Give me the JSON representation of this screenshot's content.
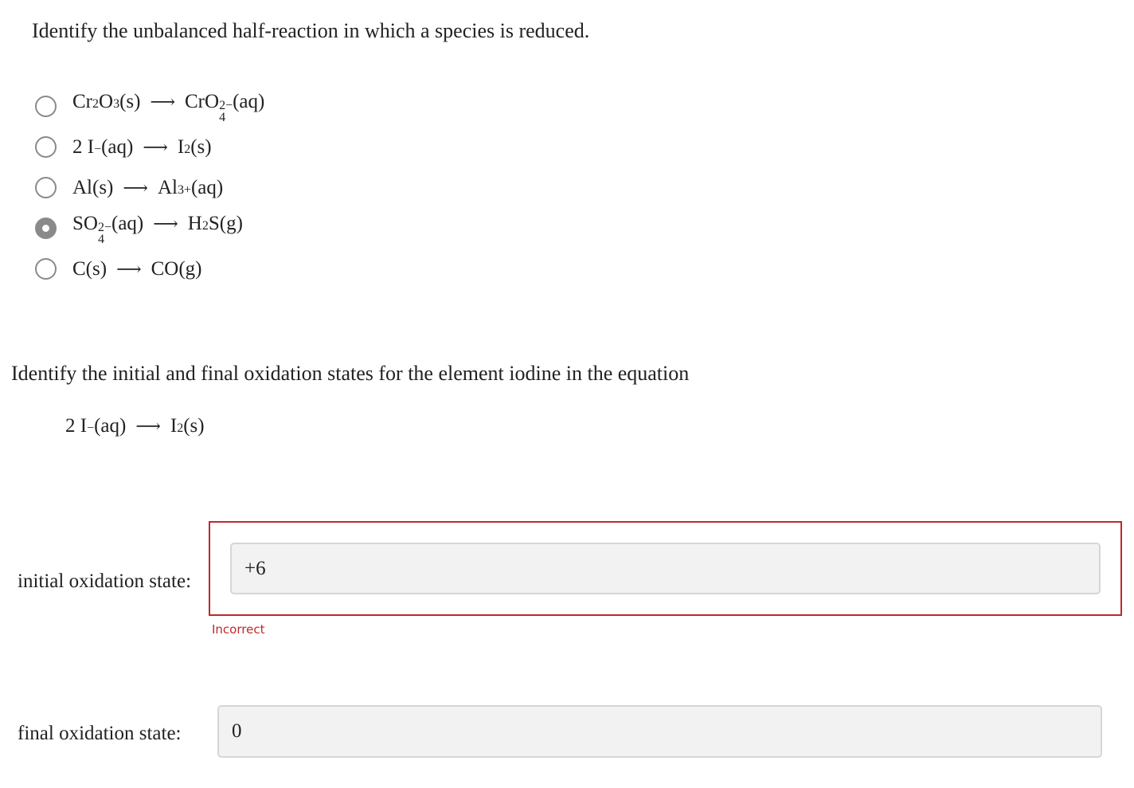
{
  "question1": {
    "prompt": "Identify the unbalanced half-reaction in which a species is reduced.",
    "options": [
      {
        "reactant_parts": [
          [
            "t",
            "Cr"
          ],
          [
            "sub",
            "2"
          ],
          [
            "t",
            "O"
          ],
          [
            "sub",
            "3"
          ],
          [
            "t",
            "(s)"
          ]
        ],
        "product_parts": [
          [
            "t",
            "CrO"
          ],
          [
            "subsup",
            "4",
            "2−"
          ],
          [
            "t",
            "(aq)"
          ]
        ],
        "selected": false
      },
      {
        "reactant_parts": [
          [
            "t",
            "2 I"
          ],
          [
            "sup",
            "−"
          ],
          [
            "t",
            "(aq)"
          ]
        ],
        "product_parts": [
          [
            "t",
            "I"
          ],
          [
            "sub",
            "2"
          ],
          [
            "t",
            "(s)"
          ]
        ],
        "selected": false
      },
      {
        "reactant_parts": [
          [
            "t",
            "Al(s)"
          ]
        ],
        "product_parts": [
          [
            "t",
            "Al"
          ],
          [
            "sup",
            "3+"
          ],
          [
            "t",
            "(aq)"
          ]
        ],
        "selected": false
      },
      {
        "reactant_parts": [
          [
            "t",
            "SO"
          ],
          [
            "subsup",
            "4",
            "2−"
          ],
          [
            "t",
            "(aq)"
          ]
        ],
        "product_parts": [
          [
            "t",
            "H"
          ],
          [
            "sub",
            "2"
          ],
          [
            "t",
            "S(g)"
          ]
        ],
        "selected": true
      },
      {
        "reactant_parts": [
          [
            "t",
            "C(s)"
          ]
        ],
        "product_parts": [
          [
            "t",
            "CO(g)"
          ]
        ],
        "selected": false
      }
    ],
    "arrow": "⟶"
  },
  "question2": {
    "prompt": "Identify the initial and final oxidation states for the element iodine in the equation",
    "equation": {
      "reactant_parts": [
        [
          "t",
          "2 I"
        ],
        [
          "sup",
          "−"
        ],
        [
          "t",
          "(aq)"
        ]
      ],
      "product_parts": [
        [
          "t",
          "I"
        ],
        [
          "sub",
          "2"
        ],
        [
          "t",
          "(s)"
        ]
      ]
    },
    "initial": {
      "label": "initial oxidation state:",
      "value": "+6",
      "feedback": "Incorrect",
      "status_color": "#c0272d"
    },
    "final": {
      "label": "final oxidation state:",
      "value": "0"
    }
  }
}
